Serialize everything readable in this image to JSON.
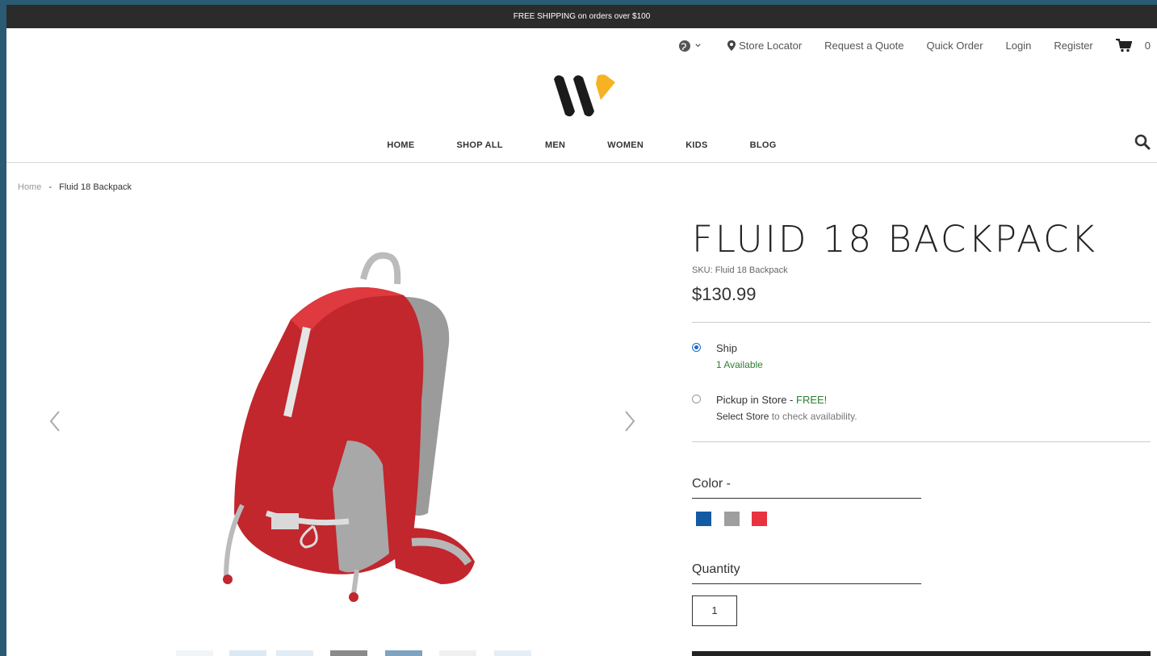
{
  "promo": {
    "text": "FREE SHIPPING on orders over $100"
  },
  "util": {
    "store_locator": "Store Locator",
    "request_quote": "Request a Quote",
    "quick_order": "Quick Order",
    "login": "Login",
    "register": "Register",
    "cart_count": "0"
  },
  "nav": [
    "HOME",
    "SHOP ALL",
    "MEN",
    "WOMEN",
    "KIDS",
    "BLOG"
  ],
  "breadcrumb": {
    "home": "Home",
    "sep": "-",
    "current": "Fluid 18 Backpack"
  },
  "product": {
    "title": "FLUID 18 BACKPACK",
    "sku": "SKU: Fluid 18 Backpack",
    "price": "$130.99"
  },
  "fulfillment": {
    "ship_label": "Ship",
    "ship_status": "1 Available",
    "pickup_label": "Pickup in Store",
    "pickup_sep": " - ",
    "pickup_free": "FREE!",
    "select_store": "Select Store",
    "select_store_rest": " to check availability."
  },
  "color": {
    "label": "Color -",
    "swatches": [
      "#1459a3",
      "#9e9e9e",
      "#e8333f"
    ]
  },
  "quantity": {
    "label": "Quantity",
    "value": "1"
  },
  "colors": {
    "promo_bg": "#2b2b2b",
    "accent": "#1b6ac9",
    "logo_dark": "#1b1b1b",
    "logo_yellow": "#f5b324",
    "available": "#2e7d32"
  }
}
